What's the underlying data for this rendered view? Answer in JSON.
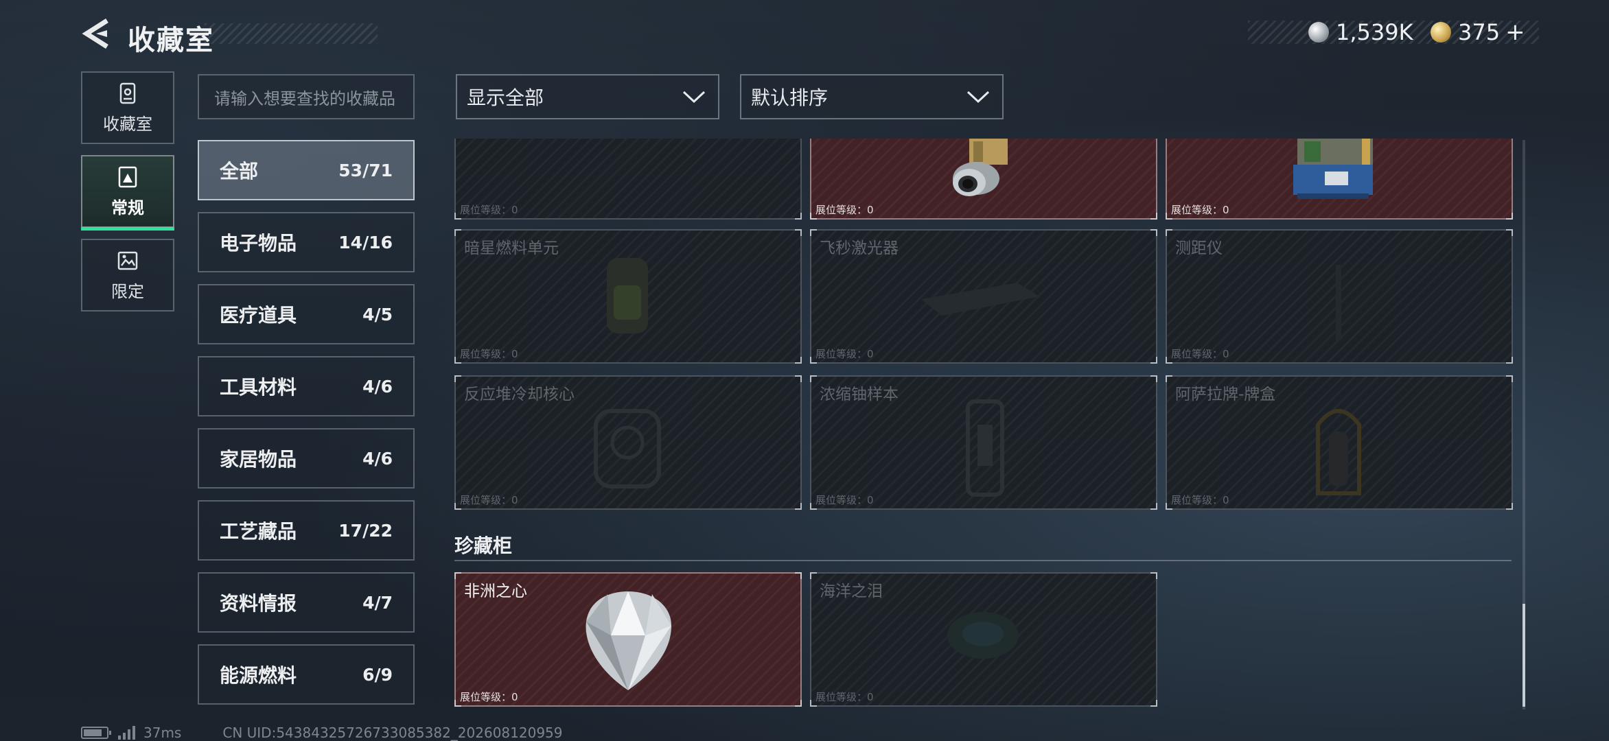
{
  "header": {
    "title": "收藏室",
    "currency_silver": "1,539K",
    "currency_gold": "375",
    "currency_add": "+"
  },
  "nav": [
    {
      "label": "收藏室",
      "icon": "collection-room-icon"
    },
    {
      "label": "常规",
      "icon": "regular-icon",
      "active": true
    },
    {
      "label": "限定",
      "icon": "limited-icon"
    }
  ],
  "search": {
    "placeholder": "请输入想要查找的收藏品"
  },
  "categories": [
    {
      "name": "全部",
      "count": "53/71",
      "active": true
    },
    {
      "name": "电子物品",
      "count": "14/16"
    },
    {
      "name": "医疗道具",
      "count": "4/5"
    },
    {
      "name": "工具材料",
      "count": "4/6"
    },
    {
      "name": "家居物品",
      "count": "4/6"
    },
    {
      "name": "工艺藏品",
      "count": "17/22"
    },
    {
      "name": "资料情报",
      "count": "4/7"
    },
    {
      "name": "能源燃料",
      "count": "6/9"
    }
  ],
  "filters": {
    "display": "显示全部",
    "sort": "默认排序"
  },
  "level_label": "展位等级：0",
  "items": [
    {
      "name": "",
      "owned": false
    },
    {
      "name": "",
      "owned": true
    },
    {
      "name": "",
      "owned": true
    },
    {
      "name": "暗星燃料单元",
      "owned": false
    },
    {
      "name": "飞秒激光器",
      "owned": false
    },
    {
      "name": "测距仪",
      "owned": false
    },
    {
      "name": "反应堆冷却核心",
      "owned": false
    },
    {
      "name": "浓缩铀样本",
      "owned": false
    },
    {
      "name": "阿萨拉牌-牌盒",
      "owned": false
    }
  ],
  "showcase": {
    "title": "珍藏柜",
    "items": [
      {
        "name": "非洲之心",
        "owned": true
      },
      {
        "name": "海洋之泪",
        "owned": false
      }
    ]
  },
  "footer": {
    "ping": "37ms",
    "uid": "CN UID:543843257267330853​82_202608120959"
  },
  "colors": {
    "accent": "#2fe39a",
    "owned_card": "#432226",
    "card": "#1c2127"
  }
}
